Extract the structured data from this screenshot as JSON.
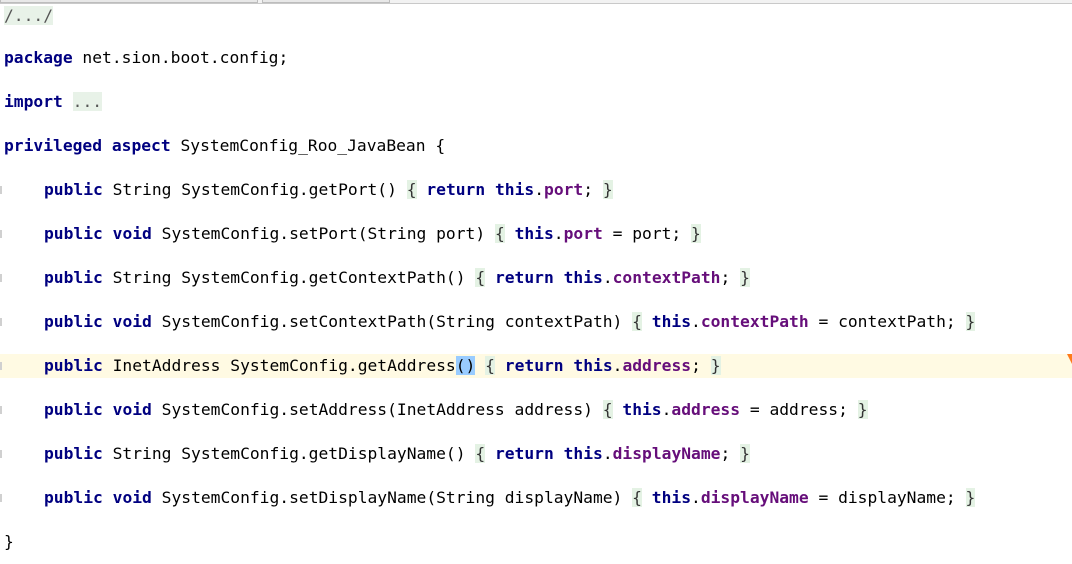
{
  "editor": {
    "header_fold": "/.../",
    "package_kw": "package",
    "package_name": " net.sion.boot.config;",
    "import_kw": "import",
    "import_fold": "...",
    "aspect": {
      "kw1": "privileged",
      "kw2": "aspect",
      "name": " SystemConfig_Roo_JavaBean {"
    },
    "closing_brace": "}",
    "methods": [
      {
        "modifier": "public",
        "return_type": " String",
        "return_is_kw": false,
        "signature": " SystemConfig.getPort() ",
        "open": "{",
        "body_kw1": "return",
        "body_kw2": "this",
        "dot": ".",
        "field": "port",
        "tail": "; ",
        "close": "}"
      },
      {
        "modifier": "public",
        "return_type": "void",
        "return_is_kw": true,
        "signature": " SystemConfig.setPort(String port) ",
        "open": "{",
        "body_kw1": "",
        "body_kw2": "this",
        "dot": ".",
        "field": "port",
        "tail": " = port; ",
        "close": "}"
      },
      {
        "modifier": "public",
        "return_type": " String",
        "return_is_kw": false,
        "signature": " SystemConfig.getContextPath() ",
        "open": "{",
        "body_kw1": "return",
        "body_kw2": "this",
        "dot": ".",
        "field": "contextPath",
        "tail": "; ",
        "close": "}"
      },
      {
        "modifier": "public",
        "return_type": "void",
        "return_is_kw": true,
        "signature": " SystemConfig.setContextPath(String contextPath) ",
        "open": "{",
        "body_kw1": "",
        "body_kw2": "this",
        "dot": ".",
        "field": "contextPath",
        "tail": " = contextPath; ",
        "close": "}"
      },
      {
        "modifier": "public",
        "return_type": " InetAddress",
        "return_is_kw": false,
        "signature_pre": " SystemConfig.getAddress",
        "signature_paren": "()",
        "signature_post": " ",
        "open": "{",
        "body_kw1": "return",
        "body_kw2": "this",
        "dot": ".",
        "field": "address",
        "tail": "; ",
        "close": "}",
        "current": true
      },
      {
        "modifier": "public",
        "return_type": "void",
        "return_is_kw": true,
        "signature": " SystemConfig.setAddress(InetAddress address) ",
        "open": "{",
        "body_kw1": "",
        "body_kw2": "this",
        "dot": ".",
        "field": "address",
        "tail": " = address; ",
        "close": "}"
      },
      {
        "modifier": "public",
        "return_type": " String",
        "return_is_kw": false,
        "signature": " SystemConfig.getDisplayName() ",
        "open": "{",
        "body_kw1": "return",
        "body_kw2": "this",
        "dot": ".",
        "field": "displayName",
        "tail": "; ",
        "close": "}"
      },
      {
        "modifier": "public",
        "return_type": "void",
        "return_is_kw": true,
        "signature": " SystemConfig.setDisplayName(String displayName) ",
        "open": "{",
        "body_kw1": "",
        "body_kw2": "this",
        "dot": ".",
        "field": "displayName",
        "tail": " = displayName; ",
        "close": "}"
      }
    ]
  },
  "colors": {
    "keyword": "#000080",
    "field": "#660e7a",
    "current_line": "#fffae3",
    "fold_background": "#e4f2e4",
    "brace_match": "#99ccff",
    "error_marker": "#ff7a1a"
  }
}
